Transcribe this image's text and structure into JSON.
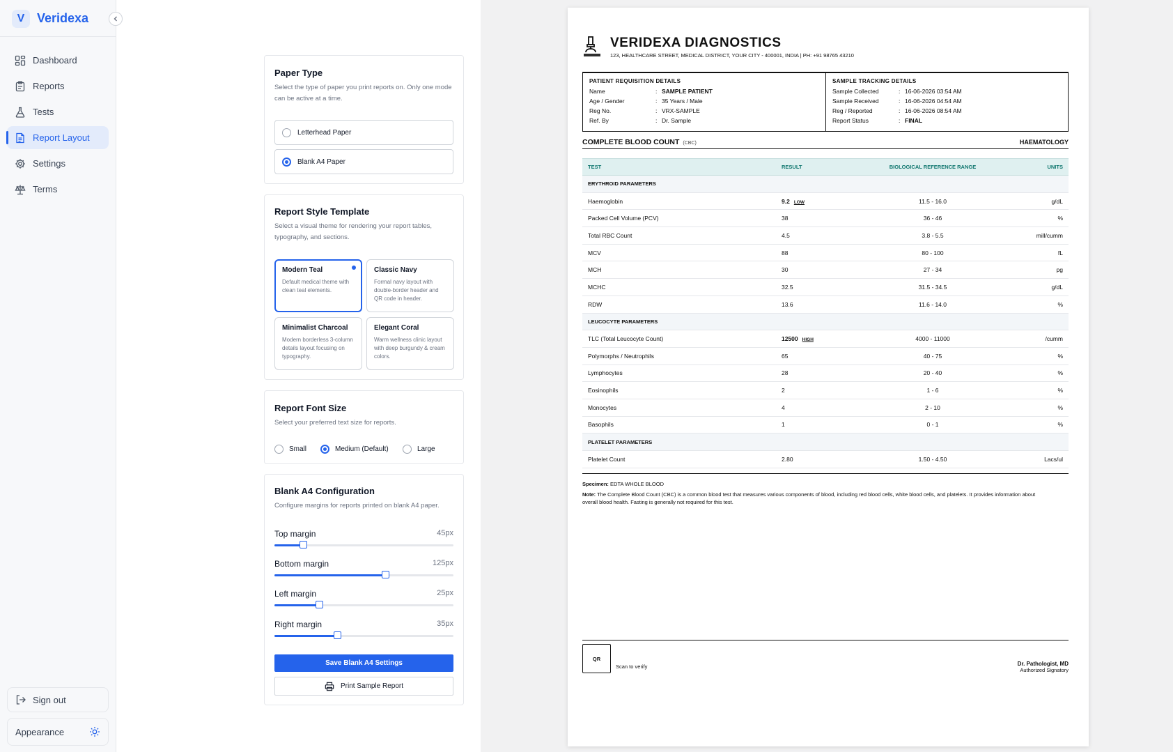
{
  "app": {
    "brand_initial": "V",
    "brand_name": "Veridexa"
  },
  "sidebar": {
    "items": [
      {
        "label": "Dashboard",
        "icon": "dashboard-icon"
      },
      {
        "label": "Reports",
        "icon": "clipboard-icon"
      },
      {
        "label": "Tests",
        "icon": "flask-icon"
      },
      {
        "label": "Report Layout",
        "icon": "document-icon",
        "active": true
      },
      {
        "label": "Settings",
        "icon": "gear-icon"
      },
      {
        "label": "Terms",
        "icon": "scale-icon"
      }
    ],
    "sign_out": "Sign out",
    "appearance": "Appearance"
  },
  "paper_type": {
    "title": "Paper Type",
    "description": "Select the type of paper you print reports on. Only one mode can be active at a time.",
    "options": [
      "Letterhead Paper",
      "Blank A4 Paper"
    ],
    "selected": "Blank A4 Paper"
  },
  "style_template": {
    "title": "Report Style Template",
    "description": "Select a visual theme for rendering your report tables, typography, and sections.",
    "templates": [
      {
        "name": "Modern Teal",
        "desc": "Default medical theme with clean teal elements."
      },
      {
        "name": "Classic Navy",
        "desc": "Formal navy layout with double-border header and QR code in header."
      },
      {
        "name": "Minimalist Charcoal",
        "desc": "Modern borderless 3-column details layout focusing on typography."
      },
      {
        "name": "Elegant Coral",
        "desc": "Warm wellness clinic layout with deep burgundy & cream colors."
      }
    ],
    "selected": "Modern Teal"
  },
  "font_size": {
    "title": "Report Font Size",
    "description": "Select your preferred text size for reports.",
    "options": [
      "Small",
      "Medium (Default)",
      "Large"
    ],
    "selected": "Medium (Default)"
  },
  "blank_a4": {
    "title": "Blank A4 Configuration",
    "description": "Configure margins for reports printed on blank A4 paper.",
    "margins": [
      {
        "label": "Top margin",
        "value": "45px",
        "level": 0.16
      },
      {
        "label": "Bottom margin",
        "value": "125px",
        "level": 0.62
      },
      {
        "label": "Left margin",
        "value": "25px",
        "level": 0.25
      },
      {
        "label": "Right margin",
        "value": "35px",
        "level": 0.35
      }
    ],
    "save_label": "Save Blank A4 Settings",
    "print_label": "Print Sample Report"
  },
  "report": {
    "lab_name": "VERIDEXA DIAGNOSTICS",
    "lab_address": "123, HEALTHCARE STREET, MEDICAL DISTRICT, YOUR CITY - 400001, INDIA  |  PH: +91 98765 43210",
    "patient_title": "PATIENT REQUISITION DETAILS",
    "patient": [
      {
        "k": "Name",
        "v": "SAMPLE PATIENT"
      },
      {
        "k": "Age / Gender",
        "v": "35 Years / Male"
      },
      {
        "k": "Reg No.",
        "v": "VRX-SAMPLE"
      },
      {
        "k": "Ref. By",
        "v": "Dr. Sample"
      }
    ],
    "tracking_title": "SAMPLE TRACKING DETAILS",
    "tracking": [
      {
        "k": "Sample Collected",
        "v": "16-06-2026 03:54 AM"
      },
      {
        "k": "Sample Received",
        "v": "16-06-2026 04:54 AM"
      },
      {
        "k": "Reg / Reported",
        "v": "16-06-2026 08:54 AM"
      },
      {
        "k": "Report Status",
        "v": "FINAL"
      }
    ],
    "test_name": "COMPLETE BLOOD COUNT",
    "test_abbr": "(CBC)",
    "department": "HAEMATOLOGY",
    "columns": [
      "TEST",
      "RESULT",
      "BIOLOGICAL REFERENCE RANGE",
      "UNITS"
    ],
    "sections": [
      {
        "name": "ERYTHROID PARAMETERS",
        "rows": [
          {
            "test": "Haemoglobin",
            "result": "9.2",
            "flag": "LOW",
            "range": "11.5 - 16.0",
            "unit": "g/dL"
          },
          {
            "test": "Packed Cell Volume (PCV)",
            "result": "38",
            "flag": "",
            "range": "36 - 46",
            "unit": "%"
          },
          {
            "test": "Total RBC Count",
            "result": "4.5",
            "flag": "",
            "range": "3.8 - 5.5",
            "unit": "mill/cumm"
          },
          {
            "test": "MCV",
            "result": "88",
            "flag": "",
            "range": "80 - 100",
            "unit": "fL"
          },
          {
            "test": "MCH",
            "result": "30",
            "flag": "",
            "range": "27 - 34",
            "unit": "pg"
          },
          {
            "test": "MCHC",
            "result": "32.5",
            "flag": "",
            "range": "31.5 - 34.5",
            "unit": "g/dL"
          },
          {
            "test": "RDW",
            "result": "13.6",
            "flag": "",
            "range": "11.6 - 14.0",
            "unit": "%"
          }
        ]
      },
      {
        "name": "LEUCOCYTE PARAMETERS",
        "rows": [
          {
            "test": "TLC (Total Leucocyte Count)",
            "result": "12500",
            "flag": "HIGH",
            "range": "4000 - 11000",
            "unit": "/cumm"
          },
          {
            "test": "Polymorphs / Neutrophils",
            "result": "65",
            "flag": "",
            "range": "40 - 75",
            "unit": "%"
          },
          {
            "test": "Lymphocytes",
            "result": "28",
            "flag": "",
            "range": "20 - 40",
            "unit": "%"
          },
          {
            "test": "Eosinophils",
            "result": "2",
            "flag": "",
            "range": "1 - 6",
            "unit": "%"
          },
          {
            "test": "Monocytes",
            "result": "4",
            "flag": "",
            "range": "2 - 10",
            "unit": "%"
          },
          {
            "test": "Basophils",
            "result": "1",
            "flag": "",
            "range": "0 - 1",
            "unit": "%"
          }
        ]
      },
      {
        "name": "PLATELET PARAMETERS",
        "rows": [
          {
            "test": "Platelet Count",
            "result": "2.80",
            "flag": "",
            "range": "1.50 - 4.50",
            "unit": "Lacs/ul"
          }
        ]
      }
    ],
    "specimen_label": "Specimen:",
    "specimen": "EDTA WHOLE BLOOD",
    "note_label": "Note:",
    "note": "The Complete Blood Count (CBC) is a common blood test that measures various components of blood, including red blood cells, white blood cells, and platelets. It provides information about overall blood health. Fasting is generally not required for this test.",
    "qr_label": "QR",
    "scan_label": "Scan to verify",
    "signatory_name": "Dr. Pathologist, MD",
    "signatory_title": "Authorized Signatory"
  }
}
